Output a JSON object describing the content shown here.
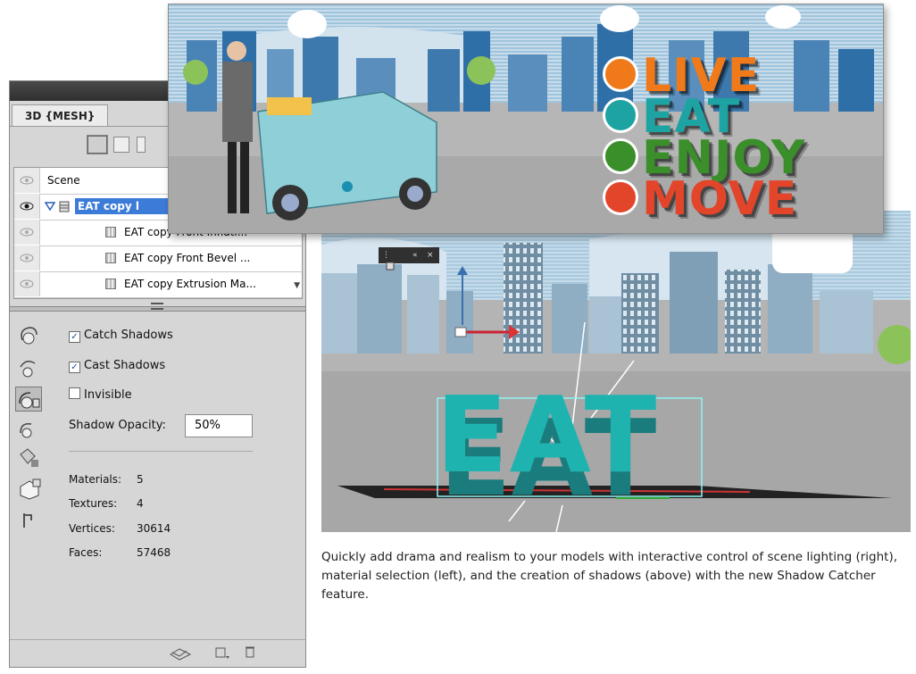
{
  "panel": {
    "tab_title": "3D {MESH}",
    "scene_rows": [
      {
        "label": "Scene",
        "type": "scene"
      },
      {
        "label": "EAT copy l",
        "type": "mesh",
        "selected": true
      },
      {
        "label": "EAT copy Front Inflati...",
        "type": "material"
      },
      {
        "label": "EAT copy Front Bevel ...",
        "type": "material"
      },
      {
        "label": "EAT copy Extrusion Ma...",
        "type": "material"
      }
    ],
    "options": {
      "catch_shadows": {
        "label": "Catch Shadows",
        "checked": true
      },
      "cast_shadows": {
        "label": "Cast Shadows",
        "checked": true
      },
      "invisible": {
        "label": "Invisible",
        "checked": false
      },
      "shadow_opacity_label": "Shadow Opacity:",
      "shadow_opacity_value": "50%"
    },
    "stats": [
      {
        "label": "Materials:",
        "value": "5"
      },
      {
        "label": "Textures:",
        "value": "4"
      },
      {
        "label": "Vertices:",
        "value": "30614"
      },
      {
        "label": "Faces:",
        "value": "57468"
      }
    ]
  },
  "banner": {
    "words": [
      "LIVE",
      "EAT",
      "ENJOY",
      "MOVE"
    ],
    "colors": {
      "live": "#f07a1a",
      "eat": "#1ea3a3",
      "enjoy": "#3a8f2a",
      "move": "#e2452a"
    }
  },
  "viewport": {
    "model_text": "EAT",
    "model_color": "#1fb3b0"
  },
  "caption": "Quickly add drama and realism to your models with interactive control of scene lighting (right), material selection (left), and the creation of shadows (above) with the new Shadow Catcher feature."
}
